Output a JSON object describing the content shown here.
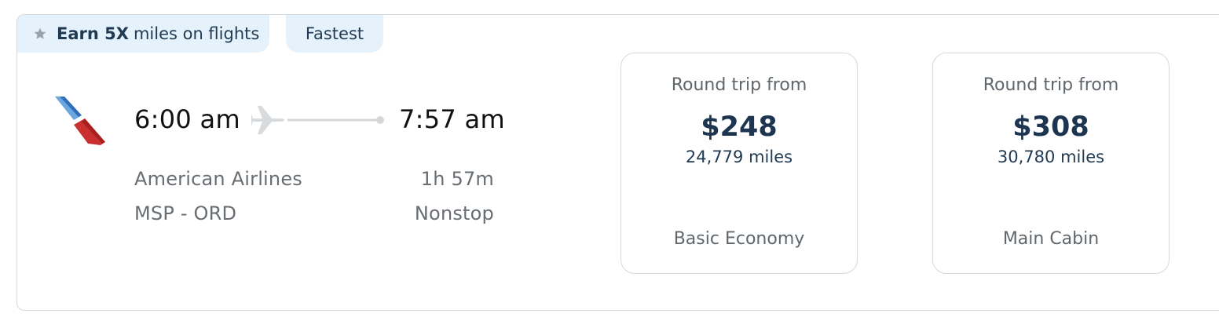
{
  "badges": {
    "earn_bold": "Earn 5X",
    "earn_rest": "miles on flights",
    "fastest": "Fastest"
  },
  "flight": {
    "departure_time": "6:00 am",
    "arrival_time": "7:57 am",
    "airline": "American Airlines",
    "route": "MSP - ORD",
    "duration": "1h 57m",
    "stops": "Nonstop"
  },
  "fares": [
    {
      "from_label": "Round trip from",
      "price": "$248",
      "miles": "24,779 miles",
      "cabin": "Basic Economy"
    },
    {
      "from_label": "Round trip from",
      "price": "$308",
      "miles": "30,780 miles",
      "cabin": "Main Cabin"
    }
  ],
  "colors": {
    "badge_bg": "#e6f2fb",
    "price_text": "#1d3550",
    "border": "#d6d9dd",
    "logo_blue": "#4a90d9",
    "logo_red": "#c8312f"
  },
  "icons": {
    "badge_icon": "star-icon",
    "airline_logo": "american-airlines-logo",
    "flight_icon": "airplane-icon"
  }
}
